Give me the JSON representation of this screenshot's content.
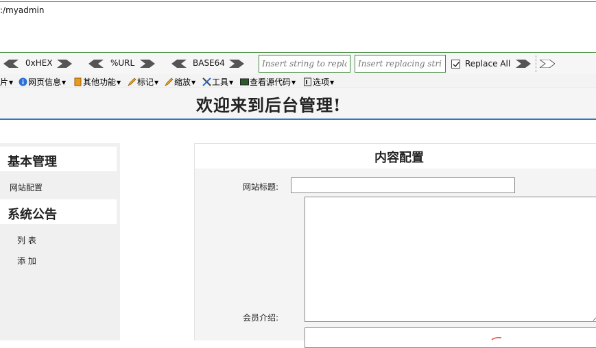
{
  "url_box": {
    "text": ":/myadmin"
  },
  "encoding_bar": {
    "hex_label": "0xHEX",
    "url_label": "%URL",
    "base64_label": "BASE64",
    "search_placeholder": "Insert string to replace",
    "replace_placeholder": "Insert replacing string",
    "replace_all_label": "Replace All",
    "replace_all_checked": true
  },
  "menu_bar": {
    "items": [
      {
        "label": "片",
        "icon": "none"
      },
      {
        "label": "网页信息",
        "icon": "info-icon"
      },
      {
        "label": "其他功能",
        "icon": "document-icon"
      },
      {
        "label": "标记",
        "icon": "pencil-icon"
      },
      {
        "label": "缩放",
        "icon": "pencil-icon"
      },
      {
        "label": "工具",
        "icon": "tools-icon"
      },
      {
        "label": "查看源代码",
        "icon": "monitor-icon"
      },
      {
        "label": "选项",
        "icon": "options-icon"
      }
    ]
  },
  "header": {
    "title": "欢迎来到后台管理!"
  },
  "sidebar": {
    "sections": [
      {
        "title": "基本管理",
        "links": [
          "网站配置"
        ]
      },
      {
        "title": "系统公告",
        "links": [
          "列 表",
          "添 加"
        ]
      }
    ]
  },
  "content": {
    "title": "内容配置",
    "site_title_label": "网站标题:",
    "site_title_value": "",
    "member_intro_label": "会员介绍:",
    "member_intro_value": ""
  },
  "colors": {
    "accent_blue": "#2f76c4",
    "hackbar_green": "#3a8a3a"
  }
}
